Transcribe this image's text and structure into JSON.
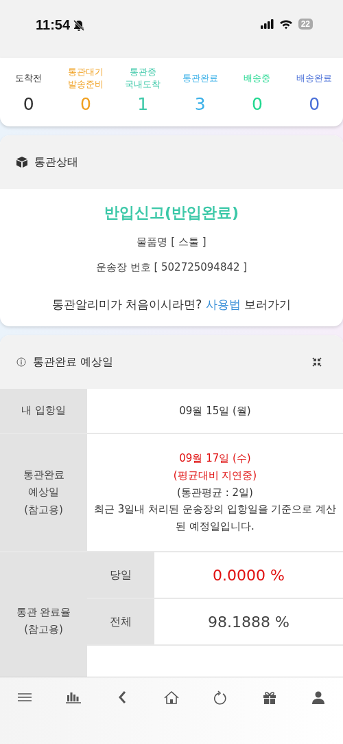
{
  "status_bar": {
    "time": "11:54",
    "battery": "22"
  },
  "summary": [
    {
      "lines": [
        "도착전"
      ],
      "count": "0",
      "color": "#333333"
    },
    {
      "lines": [
        "통관대기",
        "발송준비"
      ],
      "count": "0",
      "color": "#f0a020"
    },
    {
      "lines": [
        "통관중",
        "국내도착"
      ],
      "count": "1",
      "color": "#3cc8a8"
    },
    {
      "lines": [
        "통관완료"
      ],
      "count": "3",
      "color": "#3ab0e8"
    },
    {
      "lines": [
        "배송중"
      ],
      "count": "0",
      "color": "#22d890"
    },
    {
      "lines": [
        "배송완료"
      ],
      "count": "0",
      "color": "#4a70d8"
    }
  ],
  "customs_status": {
    "title": "통관상태",
    "status": "반입신고(반입완료)",
    "item_name": "물품명 [ 스툴 ]",
    "waybill": "운송장 번호 [ 502725094842 ]",
    "guide_before": "통관알리미가 처음이시라면? ",
    "guide_link": "사용법",
    "guide_after": " 보러가기"
  },
  "estimate": {
    "title": "통관완료 예상일",
    "arrival": {
      "label": "내 입항일",
      "value": "09월 15일 (월)"
    },
    "completion": {
      "label_lines": [
        "통관완료",
        "예상일",
        "(참고용)"
      ],
      "lines": [
        {
          "text": "09월 17일 (수)",
          "alert": true
        },
        {
          "text": "(평균대비 지연중)",
          "alert": true
        },
        {
          "text": "(통관평균 : 2일)",
          "alert": false
        },
        {
          "text": "최근 3일내 처리된 운송장의 입항일을 기준으로 계산된 예정일입니다.",
          "alert": false
        }
      ]
    },
    "rate": {
      "label_lines": [
        "통관 완료율",
        "(참고용)"
      ],
      "items": [
        {
          "label": "당일",
          "value": "0.0000 %",
          "alert": true
        },
        {
          "label": "전체",
          "value": "98.1888 %",
          "alert": false
        }
      ]
    }
  }
}
